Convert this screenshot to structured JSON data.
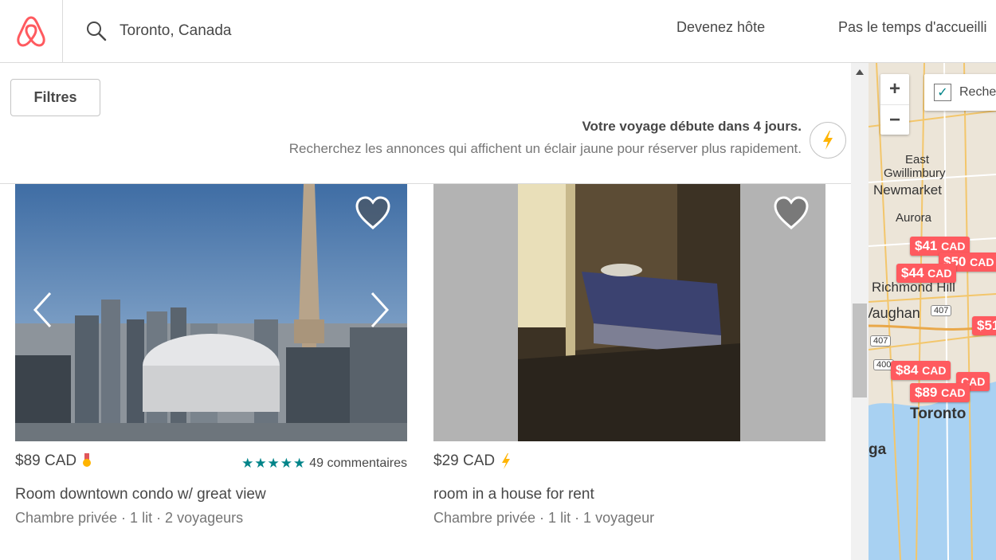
{
  "header": {
    "search_value": "Toronto, Canada",
    "nav": [
      "Devenez hôte",
      "Pas le temps d'accueilli"
    ]
  },
  "filters": {
    "label": "Filtres"
  },
  "notice": {
    "title": "Votre voyage débute dans 4 jours.",
    "subtitle": "Recherchez les annonces qui affichent un éclair jaune pour réserver plus rapidement."
  },
  "listings": [
    {
      "price": "$89 CAD",
      "stars": 5,
      "reviews": "49 commentaires",
      "title": "Room downtown condo w/ great view",
      "subtitle": "Chambre privée · 1 lit · 2 voyageurs"
    },
    {
      "price": "$29 CAD",
      "title": "room in a house for rent",
      "subtitle": "Chambre privée · 1 lit · 1 voyageur"
    }
  ],
  "map": {
    "zoom_in": "+",
    "zoom_out": "−",
    "search_toggle_label": "Recher",
    "labels": [
      "East",
      "Gwillimbury",
      "Newmarket",
      "Aurora",
      "Richmond Hill",
      "Vaughan",
      "Toronto",
      "ga"
    ],
    "road_shields": [
      "407",
      "407",
      "400"
    ],
    "pins": [
      "$41",
      "CAD",
      "$50",
      "CAD",
      "$44",
      "CAD",
      "$51",
      "$84",
      "CAD",
      "CAD",
      "$89",
      "CAD",
      "CAD"
    ]
  },
  "colors": {
    "brand": "#ff5a5f",
    "teal": "#008489",
    "bolt": "#ffb400"
  }
}
